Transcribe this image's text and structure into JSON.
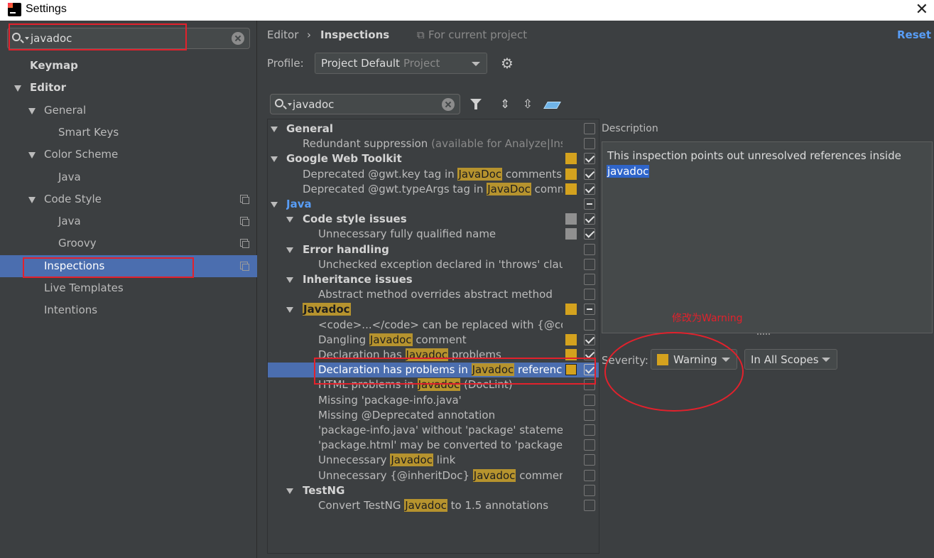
{
  "window": {
    "title": "Settings"
  },
  "sidebar": {
    "search_value": "javadoc",
    "items": [
      {
        "label": "Keymap",
        "indent": 0,
        "bold": true,
        "arrow": false,
        "copy": false,
        "selected": false
      },
      {
        "label": "Editor",
        "indent": 0,
        "bold": true,
        "arrow": true,
        "copy": false,
        "selected": false
      },
      {
        "label": "General",
        "indent": 1,
        "bold": false,
        "arrow": true,
        "copy": false,
        "selected": false
      },
      {
        "label": "Smart Keys",
        "indent": 2,
        "bold": false,
        "arrow": false,
        "copy": false,
        "selected": false
      },
      {
        "label": "Color Scheme",
        "indent": 1,
        "bold": false,
        "arrow": true,
        "copy": false,
        "selected": false
      },
      {
        "label": "Java",
        "indent": 2,
        "bold": false,
        "arrow": false,
        "copy": false,
        "selected": false
      },
      {
        "label": "Code Style",
        "indent": 1,
        "bold": false,
        "arrow": true,
        "copy": true,
        "selected": false
      },
      {
        "label": "Java",
        "indent": 2,
        "bold": false,
        "arrow": false,
        "copy": true,
        "selected": false
      },
      {
        "label": "Groovy",
        "indent": 2,
        "bold": false,
        "arrow": false,
        "copy": true,
        "selected": false
      },
      {
        "label": "Inspections",
        "indent": 1,
        "bold": false,
        "arrow": false,
        "copy": true,
        "selected": true
      },
      {
        "label": "Live Templates",
        "indent": 1,
        "bold": false,
        "arrow": false,
        "copy": false,
        "selected": false
      },
      {
        "label": "Intentions",
        "indent": 1,
        "bold": false,
        "arrow": false,
        "copy": false,
        "selected": false
      }
    ]
  },
  "header": {
    "crumb_parent": "Editor",
    "crumb_sep": "›",
    "crumb_current": "Inspections",
    "scope_note": "For current project",
    "reset_label": "Reset"
  },
  "profile": {
    "label": "Profile:",
    "value": "Project Default",
    "sub": "Project"
  },
  "toolbar": {
    "search_value": "javadoc"
  },
  "tree": [
    {
      "level": 0,
      "group": true,
      "parts": [
        {
          "t": "General"
        }
      ],
      "sev": null,
      "chk": "off"
    },
    {
      "level": 1,
      "group": false,
      "parts": [
        {
          "t": "Redundant suppression "
        },
        {
          "t": "(available for Analyze|Inspect Code)",
          "dim": true
        }
      ],
      "sev": null,
      "chk": "off"
    },
    {
      "level": 0,
      "group": true,
      "parts": [
        {
          "t": "Google Web Toolkit"
        }
      ],
      "sev": "warn",
      "chk": "on"
    },
    {
      "level": 1,
      "group": false,
      "parts": [
        {
          "t": "Deprecated @gwt.key tag in "
        },
        {
          "t": "JavaDoc",
          "hl": true
        },
        {
          "t": " comments"
        }
      ],
      "sev": "warn",
      "chk": "on"
    },
    {
      "level": 1,
      "group": false,
      "parts": [
        {
          "t": "Deprecated @gwt.typeArgs tag in "
        },
        {
          "t": "JavaDoc",
          "hl": true
        },
        {
          "t": " comments"
        }
      ],
      "sev": "warn",
      "chk": "on"
    },
    {
      "level": 0,
      "group": true,
      "java": true,
      "parts": [
        {
          "t": "Java"
        }
      ],
      "sev": null,
      "chk": "mixed"
    },
    {
      "level": 1,
      "group": true,
      "parts": [
        {
          "t": "Code style issues"
        }
      ],
      "sev": "gray",
      "chk": "on"
    },
    {
      "level": 2,
      "group": false,
      "parts": [
        {
          "t": "Unnecessary fully qualified name"
        }
      ],
      "sev": "gray",
      "chk": "on"
    },
    {
      "level": 1,
      "group": true,
      "parts": [
        {
          "t": "Error handling"
        }
      ],
      "sev": null,
      "chk": "off"
    },
    {
      "level": 2,
      "group": false,
      "parts": [
        {
          "t": "Unchecked exception declared in 'throws' clause"
        }
      ],
      "sev": null,
      "chk": "off"
    },
    {
      "level": 1,
      "group": true,
      "parts": [
        {
          "t": "Inheritance issues"
        }
      ],
      "sev": null,
      "chk": "off"
    },
    {
      "level": 2,
      "group": false,
      "parts": [
        {
          "t": "Abstract method overrides abstract method"
        }
      ],
      "sev": null,
      "chk": "off"
    },
    {
      "level": 1,
      "group": true,
      "parts": [
        {
          "t": "Javadoc",
          "hl": true
        }
      ],
      "sev": "warn",
      "chk": "mixed"
    },
    {
      "level": 2,
      "group": false,
      "parts": [
        {
          "t": "<code>...</code> can be replaced with {@code ...}"
        }
      ],
      "sev": null,
      "chk": "off"
    },
    {
      "level": 2,
      "group": false,
      "parts": [
        {
          "t": "Dangling "
        },
        {
          "t": "Javadoc",
          "hl": true
        },
        {
          "t": " comment"
        }
      ],
      "sev": "warn",
      "chk": "on"
    },
    {
      "level": 2,
      "group": false,
      "parts": [
        {
          "t": "Declaration has "
        },
        {
          "t": "Javadoc",
          "hl": true
        },
        {
          "t": " problems"
        }
      ],
      "sev": "warn",
      "chk": "on"
    },
    {
      "level": 2,
      "group": false,
      "selected": true,
      "parts": [
        {
          "t": "Declaration has problems in "
        },
        {
          "t": "Javadoc",
          "hl": true
        },
        {
          "t": " references"
        }
      ],
      "sev": "warn",
      "boxed": true,
      "chk": "on"
    },
    {
      "level": 2,
      "group": false,
      "parts": [
        {
          "t": "HTML problems in "
        },
        {
          "t": "Javadoc",
          "hl": true
        },
        {
          "t": " (DocLint)"
        }
      ],
      "sev": null,
      "chk": "off"
    },
    {
      "level": 2,
      "group": false,
      "parts": [
        {
          "t": "Missing 'package-info.java'"
        }
      ],
      "sev": null,
      "chk": "off"
    },
    {
      "level": 2,
      "group": false,
      "parts": [
        {
          "t": "Missing @Deprecated annotation"
        }
      ],
      "sev": null,
      "chk": "off"
    },
    {
      "level": 2,
      "group": false,
      "parts": [
        {
          "t": "'package-info.java' without 'package' statement"
        }
      ],
      "sev": null,
      "chk": "off"
    },
    {
      "level": 2,
      "group": false,
      "parts": [
        {
          "t": "'package.html' may be converted to 'package-info.java'"
        }
      ],
      "sev": null,
      "chk": "off"
    },
    {
      "level": 2,
      "group": false,
      "parts": [
        {
          "t": "Unnecessary "
        },
        {
          "t": "Javadoc",
          "hl": true
        },
        {
          "t": " link"
        }
      ],
      "sev": null,
      "chk": "off"
    },
    {
      "level": 2,
      "group": false,
      "parts": [
        {
          "t": "Unnecessary {@inheritDoc} "
        },
        {
          "t": "Javadoc",
          "hl": true
        },
        {
          "t": " comment"
        }
      ],
      "sev": null,
      "chk": "off"
    },
    {
      "level": 1,
      "group": true,
      "parts": [
        {
          "t": "TestNG"
        }
      ],
      "sev": null,
      "chk": "off"
    },
    {
      "level": 2,
      "group": false,
      "parts": [
        {
          "t": "Convert TestNG "
        },
        {
          "t": "Javadoc",
          "hl": true
        },
        {
          "t": " to 1.5 annotations"
        }
      ],
      "sev": null,
      "chk": "off"
    }
  ],
  "description": {
    "label": "Description",
    "text": "This inspection points out unresolved references inside",
    "selected_word": "javadoc"
  },
  "annotation": {
    "text": "修改为Warning"
  },
  "severity": {
    "label": "Severity:",
    "value": "Warning",
    "scope": "In All Scopes"
  },
  "colors": {
    "selection": "#4b6eaf",
    "warning": "#d4a21e",
    "link": "#589df6",
    "annotation_red": "#e2212c"
  }
}
